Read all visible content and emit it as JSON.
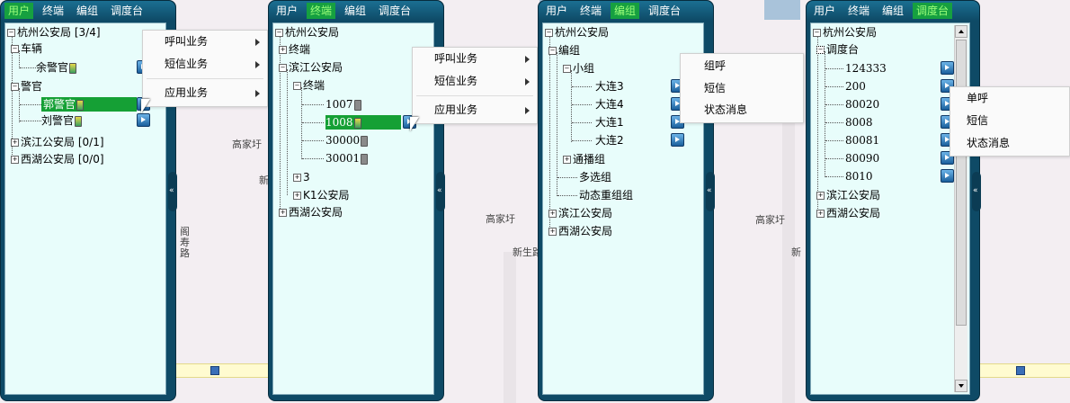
{
  "tabs": [
    "用户",
    "终端",
    "编组",
    "调度台"
  ],
  "map": {
    "place_1": "高家圩",
    "place_2": "高家圩",
    "place_3": "高家圩",
    "road_1": "新生路",
    "road_2": "新",
    "poi_1": "阁\n寿\n路"
  },
  "p1": {
    "active_tab": 0,
    "root": "杭州公安局",
    "root_count": "[3/4]",
    "vehicle": "车辆",
    "yu": "余警官",
    "police": "警官",
    "guo": "郭警官",
    "liu": "刘警官",
    "binjiang": "滨江公安局",
    "binjiang_count": "[0/1]",
    "xihu": "西湖公安局",
    "xihu_count": "[0/0]",
    "menu": [
      "呼叫业务",
      "短信业务",
      "应用业务"
    ]
  },
  "p2": {
    "active_tab": 1,
    "root": "杭州公安局",
    "terminal": "终端",
    "binjiang": "滨江公安局",
    "terminal2": "终端",
    "t1007": "1007",
    "t1008": "1008",
    "t30000": "30000",
    "t30001": "30001",
    "g3": "3",
    "k1": "K1公安局",
    "xihu": "西湖公安局",
    "menu": [
      "呼叫业务",
      "短信业务",
      "应用业务"
    ]
  },
  "p3": {
    "active_tab": 2,
    "root": "杭州公安局",
    "group": "编组",
    "xiaozu": "小组",
    "dl3": "大连3",
    "dl4": "大连4",
    "dl1": "大连1",
    "dl2": "大连2",
    "broadcast": "通播组",
    "multi": "多选组",
    "dynamic": "动态重组组",
    "binjiang": "滨江公安局",
    "xihu": "西湖公安局",
    "menu": [
      "组呼",
      "短信",
      "状态消息"
    ]
  },
  "p4": {
    "active_tab": 3,
    "root": "杭州公安局",
    "console": "调度台",
    "ids": [
      "124333",
      "200",
      "80020",
      "8008",
      "80081",
      "80090",
      "8010"
    ],
    "binjiang": "滨江公安局",
    "xihu": "西湖公安局",
    "menu": [
      "单呼",
      "短信",
      "状态消息"
    ]
  },
  "colors": {
    "panel": "#0e4a66",
    "tree_bg": "#e8fdfb",
    "selected": "#15a035",
    "active_tab_text": "#9cff7a"
  }
}
